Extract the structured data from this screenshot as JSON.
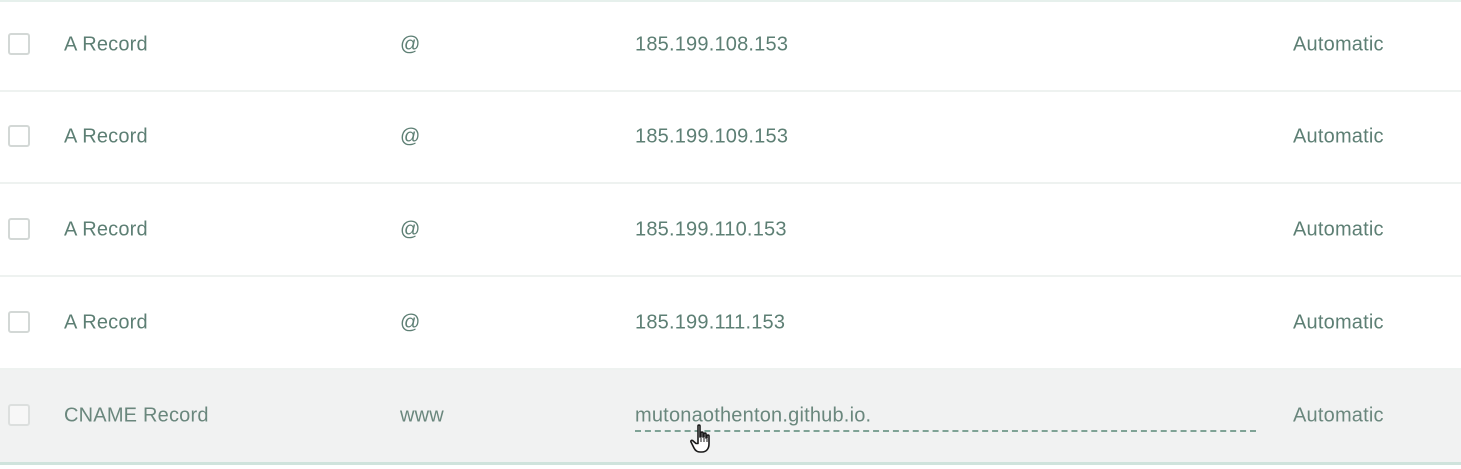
{
  "records": [
    {
      "type": "A Record",
      "host": "@",
      "value": "185.199.108.153",
      "ttl": "Automatic"
    },
    {
      "type": "A Record",
      "host": "@",
      "value": "185.199.109.153",
      "ttl": "Automatic"
    },
    {
      "type": "A Record",
      "host": "@",
      "value": "185.199.110.153",
      "ttl": "Automatic"
    },
    {
      "type": "A Record",
      "host": "@",
      "value": "185.199.111.153",
      "ttl": "Automatic"
    },
    {
      "type": "CNAME Record",
      "host": "www",
      "value": "mutonaothenton.github.io.",
      "ttl": "Automatic"
    }
  ],
  "colors": {
    "text": "#5d7f74",
    "row_highlight": "#f1f2f2",
    "divider": "#eef2f0"
  },
  "icons": {
    "cursor": "hand-pointer-icon",
    "checkbox": "checkbox-icon"
  }
}
